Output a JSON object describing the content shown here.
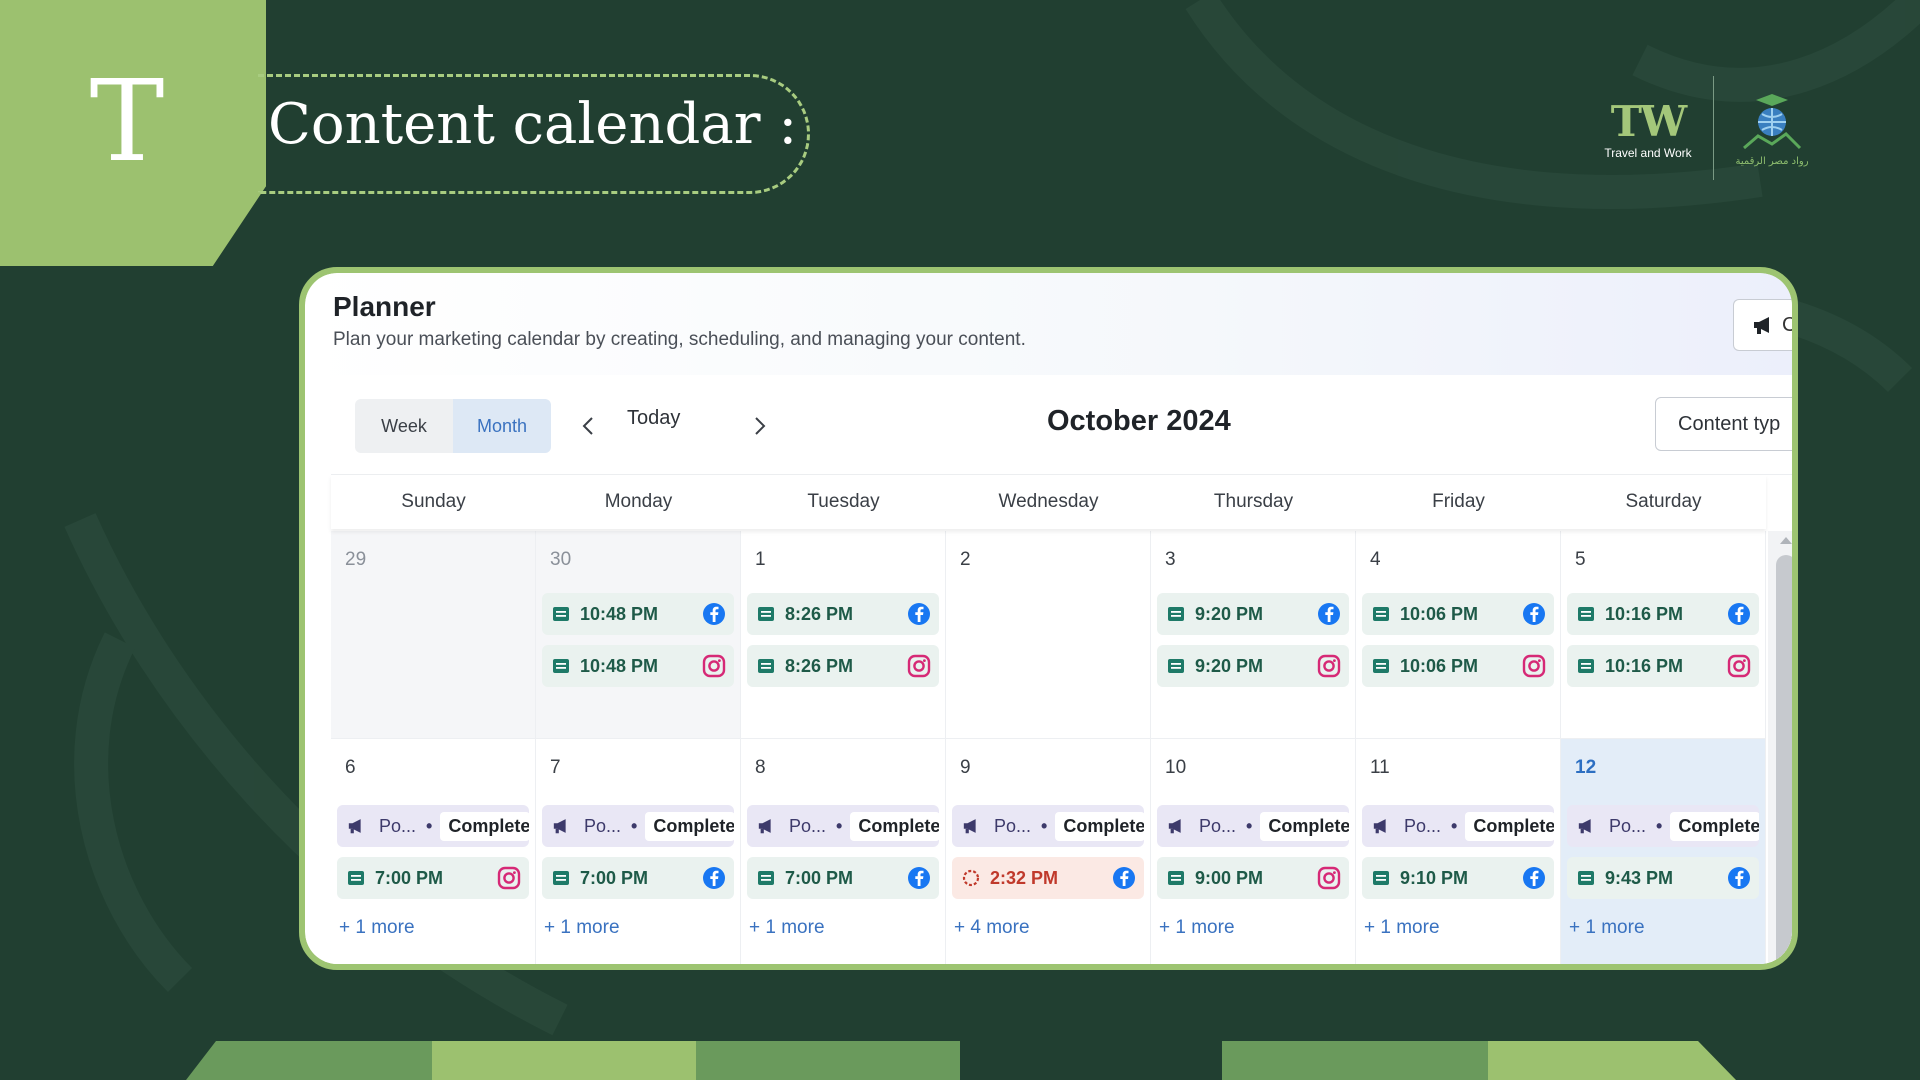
{
  "slide": {
    "badge_letter": "T",
    "title": "Content calendar :"
  },
  "logos": {
    "tw_mark": "TW",
    "tw_caption": "Travel and Work",
    "partner_caption": "رواد مصر الرقمية"
  },
  "planner": {
    "title": "Planner",
    "subtitle": "Plan your marketing calendar by creating, scheduling, and managing your content.",
    "create_label": "C"
  },
  "toolbar": {
    "week_label": "Week",
    "month_label": "Month",
    "active_view": "Month",
    "today_label": "Today",
    "month_title": "October 2024",
    "content_type_label": "Content typ"
  },
  "day_headers": [
    "Sunday",
    "Monday",
    "Tuesday",
    "Wednesday",
    "Thursday",
    "Friday",
    "Saturday"
  ],
  "weeks": [
    {
      "days": [
        {
          "date": "29",
          "outside": true,
          "events": []
        },
        {
          "date": "30",
          "outside": true,
          "events": [
            {
              "time": "10:48 PM",
              "network": "facebook"
            },
            {
              "time": "10:48 PM",
              "network": "instagram"
            }
          ]
        },
        {
          "date": "1",
          "events": [
            {
              "time": "8:26 PM",
              "network": "facebook"
            },
            {
              "time": "8:26 PM",
              "network": "instagram"
            }
          ]
        },
        {
          "date": "2",
          "events": []
        },
        {
          "date": "3",
          "events": [
            {
              "time": "9:20 PM",
              "network": "facebook"
            },
            {
              "time": "9:20 PM",
              "network": "instagram"
            }
          ]
        },
        {
          "date": "4",
          "events": [
            {
              "time": "10:06 PM",
              "network": "facebook"
            },
            {
              "time": "10:06 PM",
              "network": "instagram"
            }
          ]
        },
        {
          "date": "5",
          "events": [
            {
              "time": "10:16 PM",
              "network": "facebook"
            },
            {
              "time": "10:16 PM",
              "network": "instagram"
            }
          ]
        }
      ]
    },
    {
      "days": [
        {
          "date": "6",
          "campaign": {
            "name": "Po...",
            "status": "Complete"
          },
          "event": {
            "time": "7:00 PM",
            "network": "instagram"
          },
          "more": "+ 1 more"
        },
        {
          "date": "7",
          "campaign": {
            "name": "Po...",
            "status": "Complete"
          },
          "event": {
            "time": "7:00 PM",
            "network": "facebook"
          },
          "more": "+ 1 more"
        },
        {
          "date": "8",
          "campaign": {
            "name": "Po...",
            "status": "Complete"
          },
          "event": {
            "time": "7:00 PM",
            "network": "facebook"
          },
          "more": "+ 1 more"
        },
        {
          "date": "9",
          "campaign": {
            "name": "Po...",
            "status": "Complete"
          },
          "event": {
            "time": "2:32 PM",
            "network": "facebook",
            "pending": true
          },
          "more": "+ 4 more"
        },
        {
          "date": "10",
          "campaign": {
            "name": "Po...",
            "status": "Complete"
          },
          "event": {
            "time": "9:00 PM",
            "network": "instagram"
          },
          "more": "+ 1 more"
        },
        {
          "date": "11",
          "campaign": {
            "name": "Po...",
            "status": "Complete"
          },
          "event": {
            "time": "9:10 PM",
            "network": "facebook"
          },
          "more": "+ 1 more"
        },
        {
          "date": "12",
          "today": true,
          "campaign": {
            "name": "Po...",
            "status": "Complete"
          },
          "event": {
            "time": "9:43 PM",
            "network": "facebook"
          },
          "more": "+ 1 more"
        }
      ]
    }
  ],
  "colors": {
    "background": "#213f31",
    "accent_green": "#9cc16f",
    "facebook_blue": "#1877f2",
    "instagram_pink": "#d62976",
    "link_blue": "#3a72c0"
  }
}
